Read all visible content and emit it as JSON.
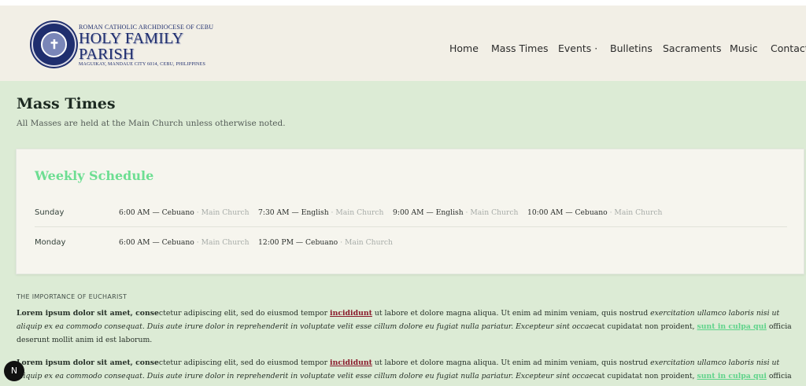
{
  "header": {
    "logo": {
      "archdiocese": "ROMAN CATHOLIC ARCHDIOCESE OF CEBU",
      "parish": "HOLY FAMILY PARISH",
      "address": "MAGUIKAY, MANDAUE CITY 6014, CEBU, PHILIPPINES"
    },
    "nav": [
      {
        "label": "Home"
      },
      {
        "label": "Mass Times"
      },
      {
        "label": "Events ·"
      },
      {
        "label": "Bulletins"
      },
      {
        "label": "Sacraments"
      },
      {
        "label": "Music"
      },
      {
        "label": "Contact"
      }
    ]
  },
  "page": {
    "title": "Mass Times",
    "subtitle": "All Masses are held at the Main Church unless otherwise noted."
  },
  "schedule": {
    "title": "Weekly Schedule",
    "rows": [
      {
        "day": "Sunday",
        "times": [
          {
            "time": "6:00 AM — Cebuano",
            "location": " · Main Church"
          },
          {
            "time": "7:30 AM — English",
            "location": " · Main Church"
          },
          {
            "time": "9:00 AM — English",
            "location": " · Main Church"
          },
          {
            "time": "10:00 AM — Cebuano",
            "location": " · Main Church"
          }
        ]
      },
      {
        "day": "Monday",
        "times": [
          {
            "time": "6:00 AM — Cebuano",
            "location": " · Main Church"
          },
          {
            "time": "12:00 PM — Cebuano",
            "location": " · Main Church"
          }
        ]
      }
    ]
  },
  "article": {
    "section_label": "THE IMPORTANCE OF EUCHARIST",
    "paragraph": {
      "bold": "Lorem ipsum dolor sit amet, conse",
      "text1": "ctetur adipiscing elit, sed do eiusmod tempor ",
      "link1": "incididunt",
      "text2": " ut labore et dolore magna aliqua. Ut enim ad minim veniam, quis nostrud ",
      "italic1": "exercitation ullamco laboris nisi ut aliquip ex ea commodo consequat. Duis aute irure dolor in reprehenderit in voluptate velit esse cillum dolore eu fugiat nulla pariatur. Excepteur sint occae",
      "text3": "cat cupidatat non proident, ",
      "link2": "sunt in culpa qui",
      "text4": " officia deserunt mollit anim id est laborum."
    }
  },
  "badge": {
    "label": "N"
  },
  "colors": {
    "header_bg": "#f2efe6",
    "main_bg": "#dcebd5",
    "accent_green": "#6dde92",
    "link_red": "#8a1a2c",
    "logo_navy": "#1f2e6e"
  }
}
